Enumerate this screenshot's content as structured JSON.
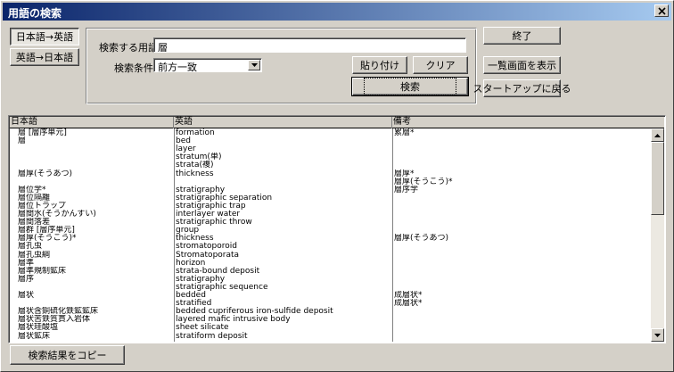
{
  "window": {
    "title": "用語の検索"
  },
  "mode_buttons": {
    "ja_en": "日本語→英語",
    "en_ja": "英語→日本語"
  },
  "search": {
    "term_label": "検索する用語:",
    "term_value": "層",
    "condition_label": "検索条件:",
    "condition_value": "前方一致"
  },
  "actions": {
    "paste": "貼り付け",
    "clear": "クリア",
    "search": "検索",
    "exit": "終了",
    "list_view": "一覧画面を表示",
    "startup": "スタートアップに戻る",
    "copy_results": "検索結果をコピー"
  },
  "icons": {
    "close": "close-icon",
    "dropdown": "chevron-down-icon",
    "scroll_up": "arrow-up-icon",
    "scroll_down": "arrow-down-icon"
  },
  "grid": {
    "headers": [
      "日本語",
      "英語",
      "備考"
    ],
    "rows": [
      [
        "層 [層序単元]",
        "formation",
        "累層*"
      ],
      [
        "層",
        "bed",
        ""
      ],
      [
        "",
        "layer",
        ""
      ],
      [
        "",
        "stratum(単)",
        ""
      ],
      [
        "",
        "strata(複)",
        ""
      ],
      [
        "層厚(そうあつ)",
        "thickness",
        "層厚*"
      ],
      [
        "",
        "",
        "層厚(そうこう)*"
      ],
      [
        "層位学*",
        "stratigraphy",
        "層序学"
      ],
      [
        "層位隔離",
        "stratigraphic separation",
        ""
      ],
      [
        "層位トラップ",
        "stratigraphic trap",
        ""
      ],
      [
        "層間水(そうかんすい)",
        "interlayer water",
        ""
      ],
      [
        "層間落差",
        "stratigraphic throw",
        ""
      ],
      [
        "層群 [層序単元]",
        "group",
        ""
      ],
      [
        "層厚(そうこう)*",
        "thickness",
        "層厚(そうあつ)"
      ],
      [
        "層孔虫",
        "stromatoporoid",
        ""
      ],
      [
        "層孔虫綱",
        "Stromatoporata",
        ""
      ],
      [
        "層準",
        "horizon",
        ""
      ],
      [
        "層準規制鉱床",
        "strata-bound deposit",
        ""
      ],
      [
        "層序",
        "stratigraphy",
        ""
      ],
      [
        "",
        "stratigraphic sequence",
        ""
      ],
      [
        "層状",
        "bedded",
        "成層状*"
      ],
      [
        "",
        "stratified",
        "成層状*"
      ],
      [
        "層状含銅硫化鉄鉱鉱床",
        "bedded cupriferous iron-sulfide deposit",
        ""
      ],
      [
        "層状苦鉄質貫入岩体",
        "layered mafic intrusive body",
        ""
      ],
      [
        "層状珪酸塩",
        "sheet silicate",
        ""
      ],
      [
        "層状鉱床",
        "stratiform deposit",
        ""
      ]
    ]
  }
}
